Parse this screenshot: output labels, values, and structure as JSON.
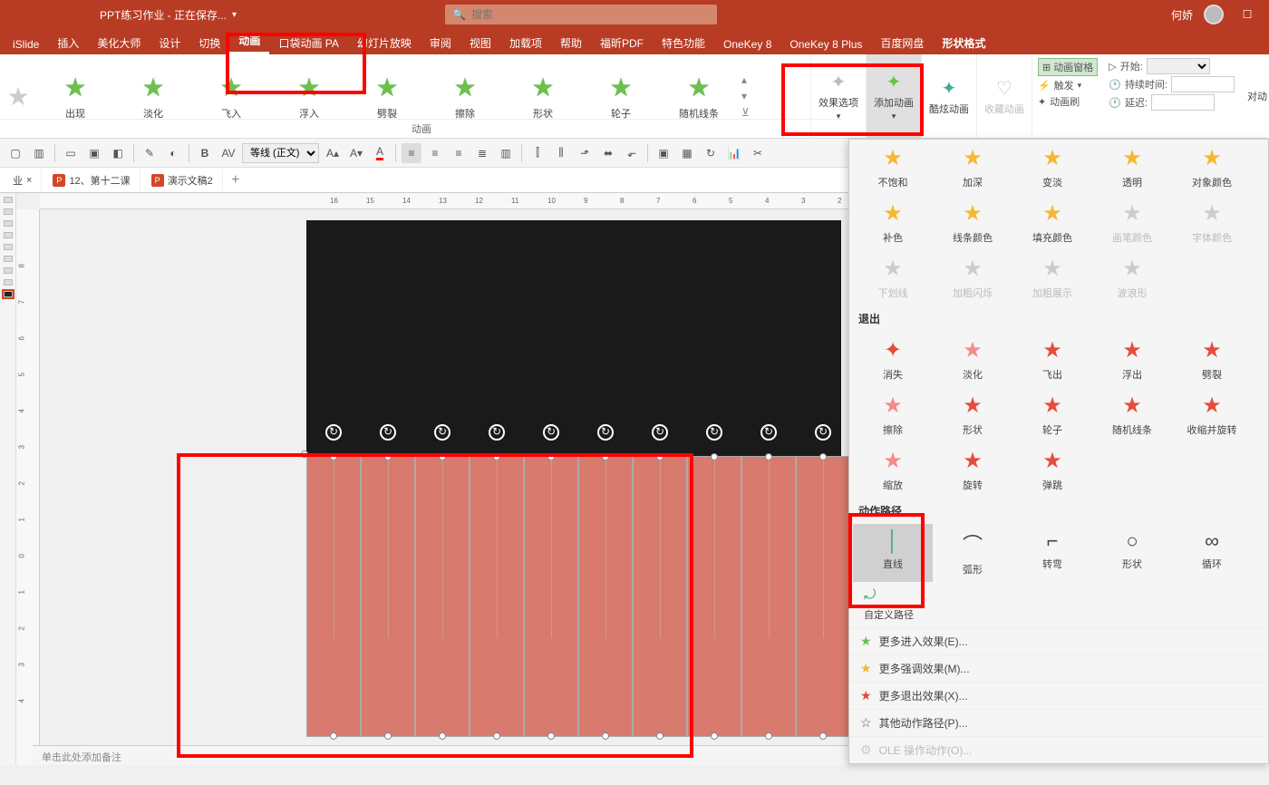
{
  "titlebar": {
    "docTitle": "PPT练习作业 - 正在保存...",
    "searchPlaceholder": "搜索",
    "username": "何娇"
  },
  "tabs": [
    "iSlide",
    "插入",
    "美化大师",
    "设计",
    "切换",
    "动画",
    "口袋动画 PA",
    "幻灯片放映",
    "审阅",
    "视图",
    "加载项",
    "帮助",
    "福昕PDF",
    "特色功能",
    "OneKey 8",
    "OneKey 8 Plus",
    "百度网盘",
    "形状格式"
  ],
  "activeTab": "动画",
  "ribbonAnims": [
    {
      "label": "出现"
    },
    {
      "label": "淡化"
    },
    {
      "label": "飞入"
    },
    {
      "label": "浮入"
    },
    {
      "label": "劈裂"
    },
    {
      "label": "擦除"
    },
    {
      "label": "形状"
    },
    {
      "label": "轮子"
    },
    {
      "label": "随机线条"
    }
  ],
  "ribbonGroupLabel": "动画",
  "ribbonButtons": {
    "effectOptions": "效果选项",
    "addAnim": "添加动画",
    "coolAnim": "酷炫动画",
    "favAnim": "收藏动画",
    "animPane": "动画窗格",
    "trigger": "触发",
    "animBrush": "动画刷",
    "start": "开始:",
    "duration": "持续时间:",
    "delay": "延迟:",
    "reorder": "对动"
  },
  "toolbar2": {
    "fontName": "等线 (正文)"
  },
  "doctabs": {
    "tab0": "业",
    "tab1": "12、第十二课",
    "tab2": "演示文稿2"
  },
  "dropdown": {
    "emphasis": [
      {
        "label": "不饱和",
        "cls": "yellow"
      },
      {
        "label": "加深",
        "cls": "yellow"
      },
      {
        "label": "变淡",
        "cls": "yellow"
      },
      {
        "label": "透明",
        "cls": "yellow"
      },
      {
        "label": "对象颜色",
        "cls": "yellow"
      },
      {
        "label": "补色",
        "cls": "yellow"
      },
      {
        "label": "线条颜色",
        "cls": "yellow"
      },
      {
        "label": "填充颜色",
        "cls": "yellow"
      },
      {
        "label": "画笔颜色",
        "cls": "gray",
        "disabled": true
      },
      {
        "label": "字体颜色",
        "cls": "gray",
        "disabled": true
      },
      {
        "label": "下划线",
        "cls": "gray",
        "disabled": true
      },
      {
        "label": "加粗闪烁",
        "cls": "gray",
        "disabled": true
      },
      {
        "label": "加粗展示",
        "cls": "gray",
        "disabled": true
      },
      {
        "label": "波浪形",
        "cls": "gray",
        "disabled": true
      }
    ],
    "exitTitle": "退出",
    "exit": [
      {
        "label": "消失"
      },
      {
        "label": "淡化"
      },
      {
        "label": "飞出"
      },
      {
        "label": "浮出"
      },
      {
        "label": "劈裂"
      },
      {
        "label": "擦除"
      },
      {
        "label": "形状"
      },
      {
        "label": "轮子"
      },
      {
        "label": "随机线条"
      },
      {
        "label": "收缩并旋转"
      },
      {
        "label": "缩放"
      },
      {
        "label": "旋转"
      },
      {
        "label": "弹跳"
      }
    ],
    "pathTitle": "动作路径",
    "paths": [
      {
        "label": "直线",
        "ico": "│",
        "sel": true
      },
      {
        "label": "弧形",
        "ico": "⌒"
      },
      {
        "label": "转弯",
        "ico": "⌐"
      },
      {
        "label": "形状",
        "ico": "○"
      },
      {
        "label": "循环",
        "ico": "∞"
      }
    ],
    "customPath": "自定义路径",
    "moreEntry": "更多进入效果(E)...",
    "moreEmphasis": "更多强调效果(M)...",
    "moreExit": "更多退出效果(X)...",
    "morePath": "其他动作路径(P)...",
    "oleAction": "OLE 操作动作(O)..."
  },
  "notes": "单击此处添加备注"
}
